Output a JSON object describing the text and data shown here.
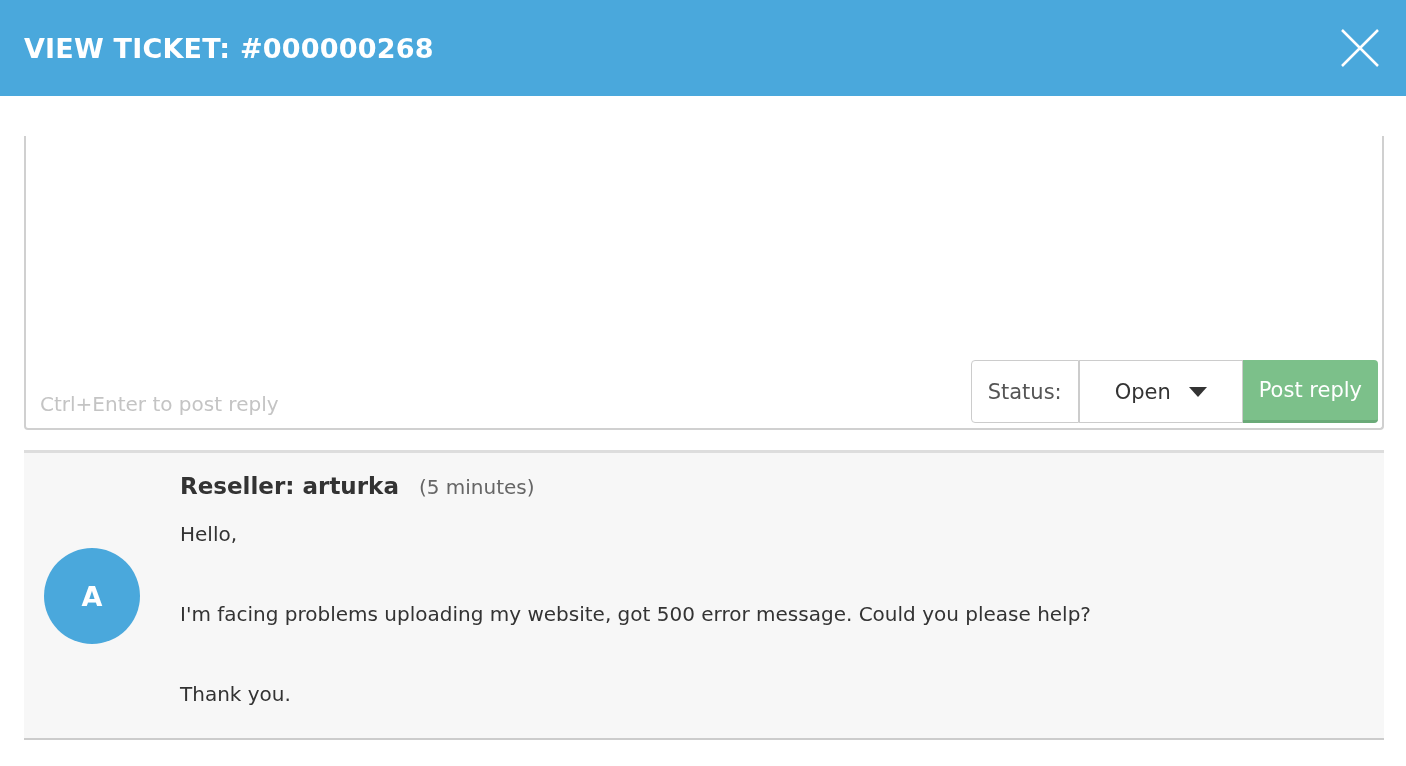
{
  "window": {
    "title": "VIEW TICKET: #000000268"
  },
  "reply": {
    "placeholder": "Ctrl+Enter to post reply",
    "status_label": "Status:",
    "status_value": "Open",
    "submit": "Post reply"
  },
  "messages": [
    {
      "avatar": "A",
      "author": "Reseller: arturka",
      "time": "(5 minutes)",
      "paragraphs": [
        "Hello,",
        "I'm facing problems uploading my website, got 500 error message. Could you please help?",
        "Thank you."
      ]
    }
  ]
}
